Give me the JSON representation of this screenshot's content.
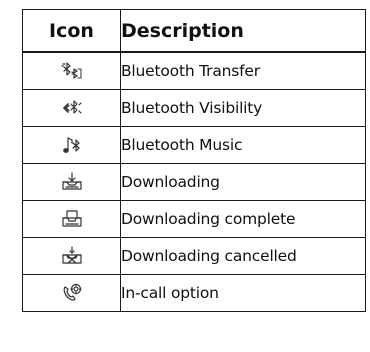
{
  "table": {
    "header_icon": "Icon",
    "header_description": "Description",
    "rows": [
      {
        "icon": "bluetooth-transfer-icon",
        "description": "Bluetooth Transfer"
      },
      {
        "icon": "bluetooth-visibility-icon",
        "description": "Bluetooth Visibility"
      },
      {
        "icon": "bluetooth-music-icon",
        "description": "Bluetooth Music"
      },
      {
        "icon": "downloading-icon",
        "description": "Downloading"
      },
      {
        "icon": "downloading-complete-icon",
        "description": "Downloading complete"
      },
      {
        "icon": "downloading-cancelled-icon",
        "description": "Downloading cancelled"
      },
      {
        "icon": "in-call-option-icon",
        "description": "In-call option"
      }
    ]
  }
}
